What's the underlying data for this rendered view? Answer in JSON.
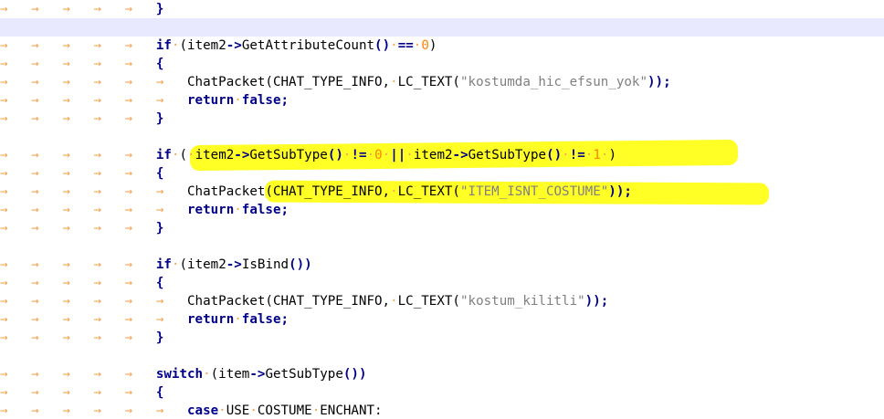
{
  "editor": {
    "lines": [
      [
        {
          "t": "→   →   →   →   →   ",
          "c": "ws"
        },
        {
          "t": "}",
          "c": "op"
        }
      ],
      [],
      [
        {
          "t": "→   →   →   →   →   ",
          "c": "ws"
        },
        {
          "t": "if",
          "c": "kw"
        },
        {
          "t": "·",
          "c": "dot"
        },
        {
          "t": "(item2",
          "c": "txt"
        },
        {
          "t": "->",
          "c": "op"
        },
        {
          "t": "GetAttributeCount",
          "c": "txt"
        },
        {
          "t": "()",
          "c": "op"
        },
        {
          "t": "·",
          "c": "dot"
        },
        {
          "t": "==",
          "c": "op"
        },
        {
          "t": "·",
          "c": "dot"
        },
        {
          "t": "0",
          "c": "num"
        },
        {
          "t": ")",
          "c": "txt"
        }
      ],
      [
        {
          "t": "→   →   →   →   →   ",
          "c": "ws"
        },
        {
          "t": "{",
          "c": "op"
        }
      ],
      [
        {
          "t": "→   →   →   →   →   →   ",
          "c": "ws"
        },
        {
          "t": "ChatPacket(CHAT_TYPE_INFO,",
          "c": "txt"
        },
        {
          "t": "·",
          "c": "dot"
        },
        {
          "t": "LC_TEXT(",
          "c": "txt"
        },
        {
          "t": "\"kostumda_hic_efsun_yok\"",
          "c": "str"
        },
        {
          "t": "));",
          "c": "op"
        }
      ],
      [
        {
          "t": "→   →   →   →   →   →   ",
          "c": "ws"
        },
        {
          "t": "return",
          "c": "kw"
        },
        {
          "t": "·",
          "c": "dot"
        },
        {
          "t": "false",
          "c": "kw"
        },
        {
          "t": ";",
          "c": "op"
        }
      ],
      [
        {
          "t": "→   →   →   →   →   ",
          "c": "ws"
        },
        {
          "t": "}",
          "c": "op"
        }
      ],
      [],
      [
        {
          "t": "→   →   →   →   →   ",
          "c": "ws"
        },
        {
          "t": "if",
          "c": "kw"
        },
        {
          "t": "·",
          "c": "dot"
        },
        {
          "t": "(",
          "c": "txt"
        },
        {
          "t": "·",
          "c": "dot"
        },
        {
          "t": "item2",
          "c": "txt"
        },
        {
          "t": "->",
          "c": "op"
        },
        {
          "t": "GetSubType",
          "c": "txt"
        },
        {
          "t": "()",
          "c": "op"
        },
        {
          "t": "·",
          "c": "dot"
        },
        {
          "t": "!=",
          "c": "op"
        },
        {
          "t": "·",
          "c": "dot"
        },
        {
          "t": "0",
          "c": "num"
        },
        {
          "t": "·",
          "c": "dot"
        },
        {
          "t": "||",
          "c": "op"
        },
        {
          "t": "·",
          "c": "dot"
        },
        {
          "t": "item2",
          "c": "txt"
        },
        {
          "t": "->",
          "c": "op"
        },
        {
          "t": "GetSubType",
          "c": "txt"
        },
        {
          "t": "()",
          "c": "op"
        },
        {
          "t": "·",
          "c": "dot"
        },
        {
          "t": "!=",
          "c": "op"
        },
        {
          "t": "·",
          "c": "dot"
        },
        {
          "t": "1",
          "c": "num"
        },
        {
          "t": "·",
          "c": "dot"
        },
        {
          "t": ")",
          "c": "txt"
        }
      ],
      [
        {
          "t": "→   →   →   →   →   ",
          "c": "ws"
        },
        {
          "t": "{",
          "c": "op"
        }
      ],
      [
        {
          "t": "→   →   →   →   →   →   ",
          "c": "ws"
        },
        {
          "t": "ChatPacket(CHAT_TYPE_INFO,",
          "c": "txt"
        },
        {
          "t": "·",
          "c": "dot"
        },
        {
          "t": "LC_TEXT(",
          "c": "txt"
        },
        {
          "t": "\"ITEM_ISNT_COSTUME\"",
          "c": "str"
        },
        {
          "t": "));",
          "c": "op"
        }
      ],
      [
        {
          "t": "→   →   →   →   →   →   ",
          "c": "ws"
        },
        {
          "t": "return",
          "c": "kw"
        },
        {
          "t": "·",
          "c": "dot"
        },
        {
          "t": "false",
          "c": "kw"
        },
        {
          "t": ";",
          "c": "op"
        }
      ],
      [
        {
          "t": "→   →   →   →   →   ",
          "c": "ws"
        },
        {
          "t": "}",
          "c": "op"
        }
      ],
      [],
      [
        {
          "t": "→   →   →   →   →   ",
          "c": "ws"
        },
        {
          "t": "if",
          "c": "kw"
        },
        {
          "t": "·",
          "c": "dot"
        },
        {
          "t": "(item2",
          "c": "txt"
        },
        {
          "t": "->",
          "c": "op"
        },
        {
          "t": "IsBind",
          "c": "txt"
        },
        {
          "t": "())",
          "c": "op"
        }
      ],
      [
        {
          "t": "→   →   →   →   →   ",
          "c": "ws"
        },
        {
          "t": "{",
          "c": "op"
        }
      ],
      [
        {
          "t": "→   →   →   →   →   →   ",
          "c": "ws"
        },
        {
          "t": "ChatPacket(CHAT_TYPE_INFO,",
          "c": "txt"
        },
        {
          "t": "·",
          "c": "dot"
        },
        {
          "t": "LC_TEXT(",
          "c": "txt"
        },
        {
          "t": "\"kostum_kilitli\"",
          "c": "str"
        },
        {
          "t": "));",
          "c": "op"
        }
      ],
      [
        {
          "t": "→   →   →   →   →   →   ",
          "c": "ws"
        },
        {
          "t": "return",
          "c": "kw"
        },
        {
          "t": "·",
          "c": "dot"
        },
        {
          "t": "false",
          "c": "kw"
        },
        {
          "t": ";",
          "c": "op"
        }
      ],
      [
        {
          "t": "→   →   →   →   →   ",
          "c": "ws"
        },
        {
          "t": "}",
          "c": "op"
        }
      ],
      [],
      [
        {
          "t": "→   →   →   →   →   ",
          "c": "ws"
        },
        {
          "t": "switch",
          "c": "kw"
        },
        {
          "t": "·",
          "c": "dot"
        },
        {
          "t": "(item",
          "c": "txt"
        },
        {
          "t": "->",
          "c": "op"
        },
        {
          "t": "GetSubType",
          "c": "txt"
        },
        {
          "t": "())",
          "c": "op"
        }
      ],
      [
        {
          "t": "→   →   →   →   →   ",
          "c": "ws"
        },
        {
          "t": "{",
          "c": "op"
        }
      ],
      [
        {
          "t": "→   →   →   →   →   →   ",
          "c": "ws"
        },
        {
          "t": "case",
          "c": "kw"
        },
        {
          "t": "·",
          "c": "dot"
        },
        {
          "t": "USE",
          "c": "txt"
        },
        {
          "t": "·",
          "c": "dot"
        },
        {
          "t": "COSTUME",
          "c": "txt"
        },
        {
          "t": "·",
          "c": "dot"
        },
        {
          "t": "ENCHANT:",
          "c": "txt"
        }
      ]
    ],
    "current_line_index": 1,
    "highlight_color": "#ffff00",
    "whitespace_color": "#f3a552",
    "keyword_color": "#00008b",
    "number_color": "#ff8000",
    "string_color": "#808080",
    "current_line_bg": "#e8e8ff"
  }
}
